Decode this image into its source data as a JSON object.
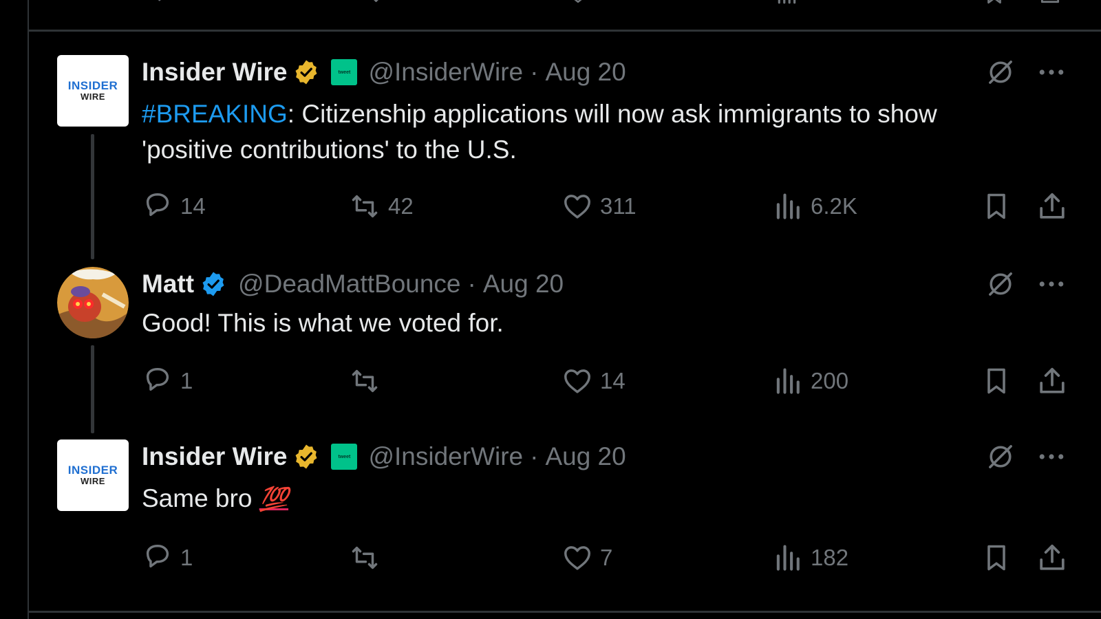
{
  "colors": {
    "background": "#000000",
    "text": "#e7e9ea",
    "muted": "#71767b",
    "link": "#1d9bf0",
    "gold_badge": "#e8b62d",
    "blue_badge": "#1d9bf0",
    "divider": "#2f3336"
  },
  "tweets": [
    {
      "author": {
        "name": "Insider Wire",
        "handle": "@InsiderWire",
        "verified": "gold",
        "avatar_text": [
          "INSIDER",
          "WIRE"
        ],
        "affiliate_badge": "icon"
      },
      "separator": "·",
      "date": "Aug 20",
      "text": {
        "hashtag": "#BREAKING",
        "body": ": Citizenship applications will now ask immigrants to show 'positive contributions' to the U.S."
      },
      "stats": {
        "replies": "14",
        "reposts": "42",
        "likes": "311",
        "views": "6.2K"
      }
    },
    {
      "author": {
        "name": "Matt",
        "handle": "@DeadMattBounce",
        "verified": "blue"
      },
      "separator": "·",
      "date": "Aug 20",
      "text": {
        "body": "Good! This is what we voted for."
      },
      "stats": {
        "replies": "1",
        "reposts": "",
        "likes": "14",
        "views": "200"
      }
    },
    {
      "author": {
        "name": "Insider Wire",
        "handle": "@InsiderWire",
        "verified": "gold",
        "avatar_text": [
          "INSIDER",
          "WIRE"
        ],
        "affiliate_badge": "icon"
      },
      "separator": "·",
      "date": "Aug 20",
      "text": {
        "body": "Same bro ",
        "emoji": "💯"
      },
      "stats": {
        "replies": "1",
        "reposts": "",
        "likes": "7",
        "views": "182"
      }
    }
  ],
  "icons": [
    "reply-icon",
    "repost-icon",
    "like-icon",
    "views-icon",
    "bookmark-icon",
    "share-icon",
    "grok-icon",
    "more-icon",
    "verified-badge-icon"
  ]
}
